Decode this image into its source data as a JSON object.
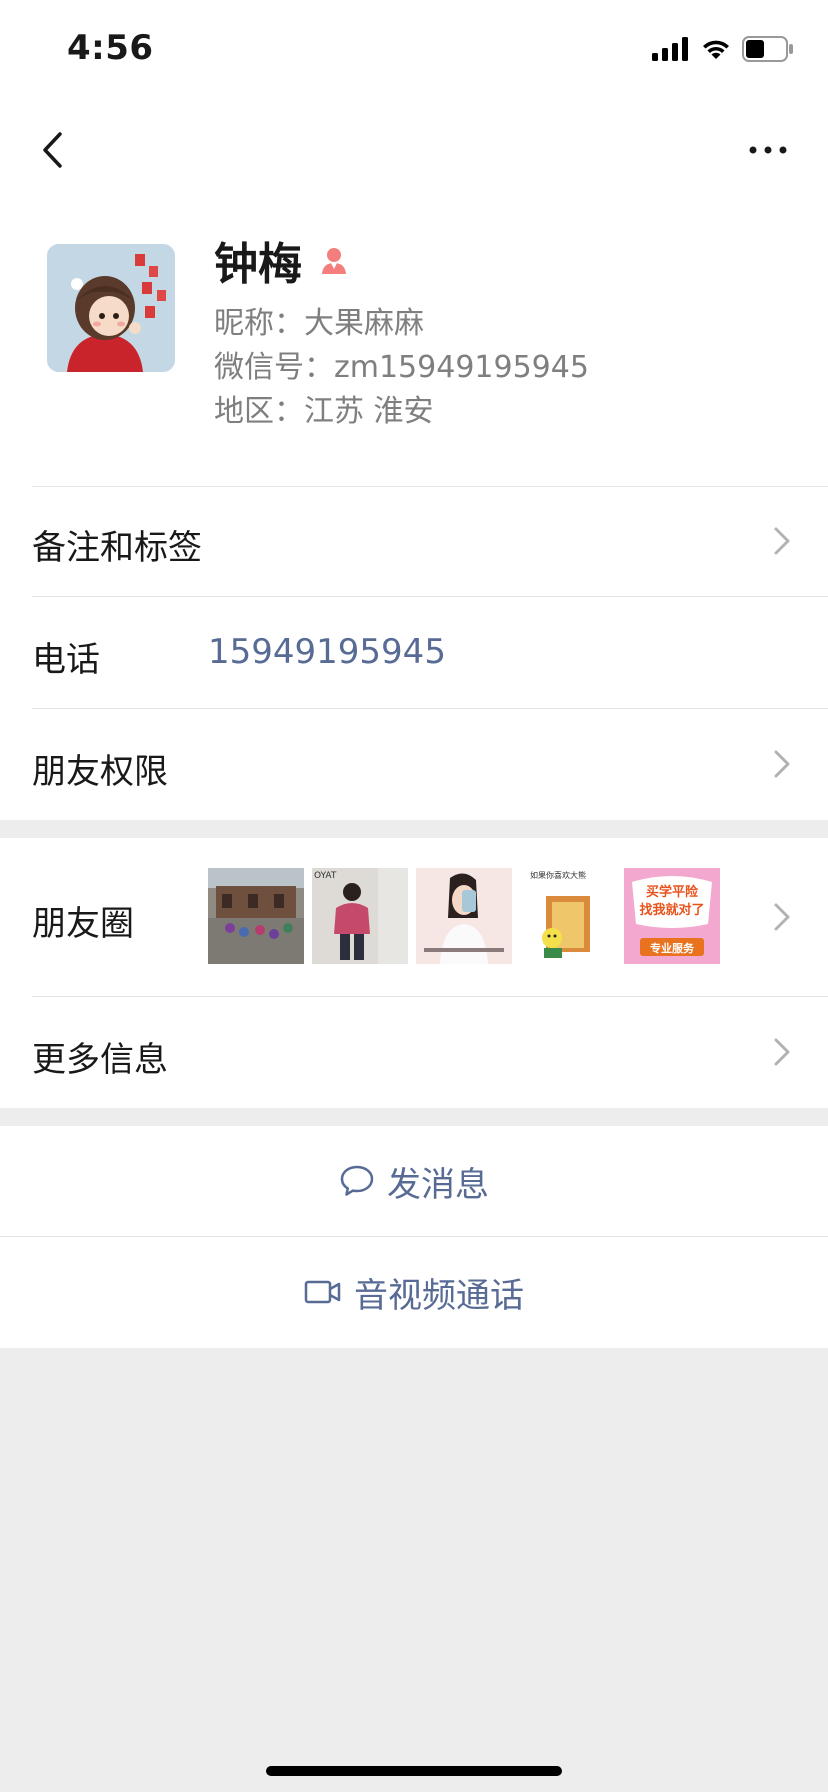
{
  "status": {
    "time": "4:56"
  },
  "profile": {
    "name": "钟梅",
    "nickname": "昵称：大果麻麻",
    "wechat_id": "微信号：zm15949195945",
    "region": "地区：江苏 淮安"
  },
  "rows": {
    "remarks": "备注和标签",
    "phone_label": "电话",
    "phone_value": "15949195945",
    "permissions": "朋友权限",
    "moments": "朋友圈",
    "more_info": "更多信息"
  },
  "moments_thumbs": {
    "thumb3_caption": "如果你喜欢大熊",
    "thumb5_line1": "买学平险",
    "thumb5_line2": "找我就对了",
    "thumb5_tag": "专业服务",
    "thumb2_tag": "OYAT"
  },
  "actions": {
    "message": "发消息",
    "call": "音视频通话"
  },
  "colors": {
    "link": "#576b95",
    "gender_female": "#f37e7d",
    "background": "#ededed"
  },
  "icons": {
    "back": "chevron-left-icon",
    "more": "more-dots-icon",
    "chevron": "chevron-right-icon",
    "message": "chat-bubble-icon",
    "video": "video-camera-icon",
    "gender": "female-icon"
  }
}
